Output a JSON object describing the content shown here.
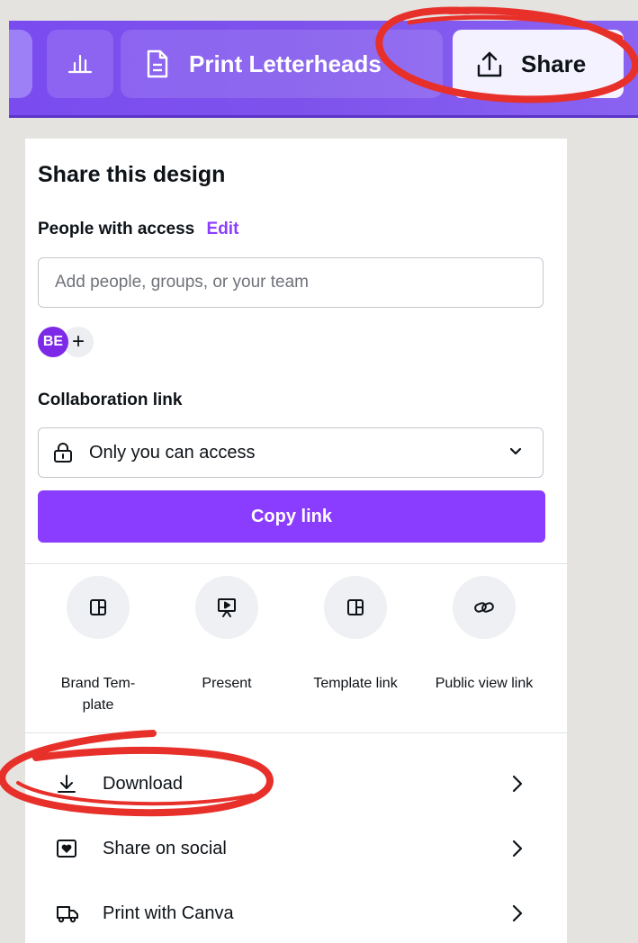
{
  "toolbar": {
    "chart_icon": "bar-chart-icon",
    "print_label": "Print Letterheads",
    "print_icon": "document-icon",
    "share_label": "Share",
    "share_icon": "upload-icon"
  },
  "panel": {
    "title": "Share this design",
    "people_label": "People with access",
    "edit_label": "Edit",
    "people_placeholder": "Add people, groups, or your team",
    "avatar_initials": "BE",
    "add_symbol": "+",
    "collab_label": "Collaboration link",
    "collab_value": "Only you can access",
    "copy_label": "Copy link"
  },
  "share_options": [
    {
      "label_line1": "Brand Tem-",
      "label_line2": "plate",
      "icon": "template-icon"
    },
    {
      "label_line1": "Present",
      "label_line2": "",
      "icon": "present-icon"
    },
    {
      "label_line1": "Template link",
      "label_line2": "",
      "icon": "template-link-icon"
    },
    {
      "label_line1": "Public view link",
      "label_line2": "",
      "icon": "link-icon"
    }
  ],
  "menu": [
    {
      "label": "Download",
      "icon": "download-icon"
    },
    {
      "label": "Share on social",
      "icon": "heart-icon"
    },
    {
      "label": "Print with Canva",
      "icon": "truck-icon"
    }
  ],
  "colors": {
    "brand_purple": "#8b3dff",
    "toolbar_purple": "#7d52ec",
    "annotation_red": "#e8302a",
    "background": "#e5e3e0"
  }
}
